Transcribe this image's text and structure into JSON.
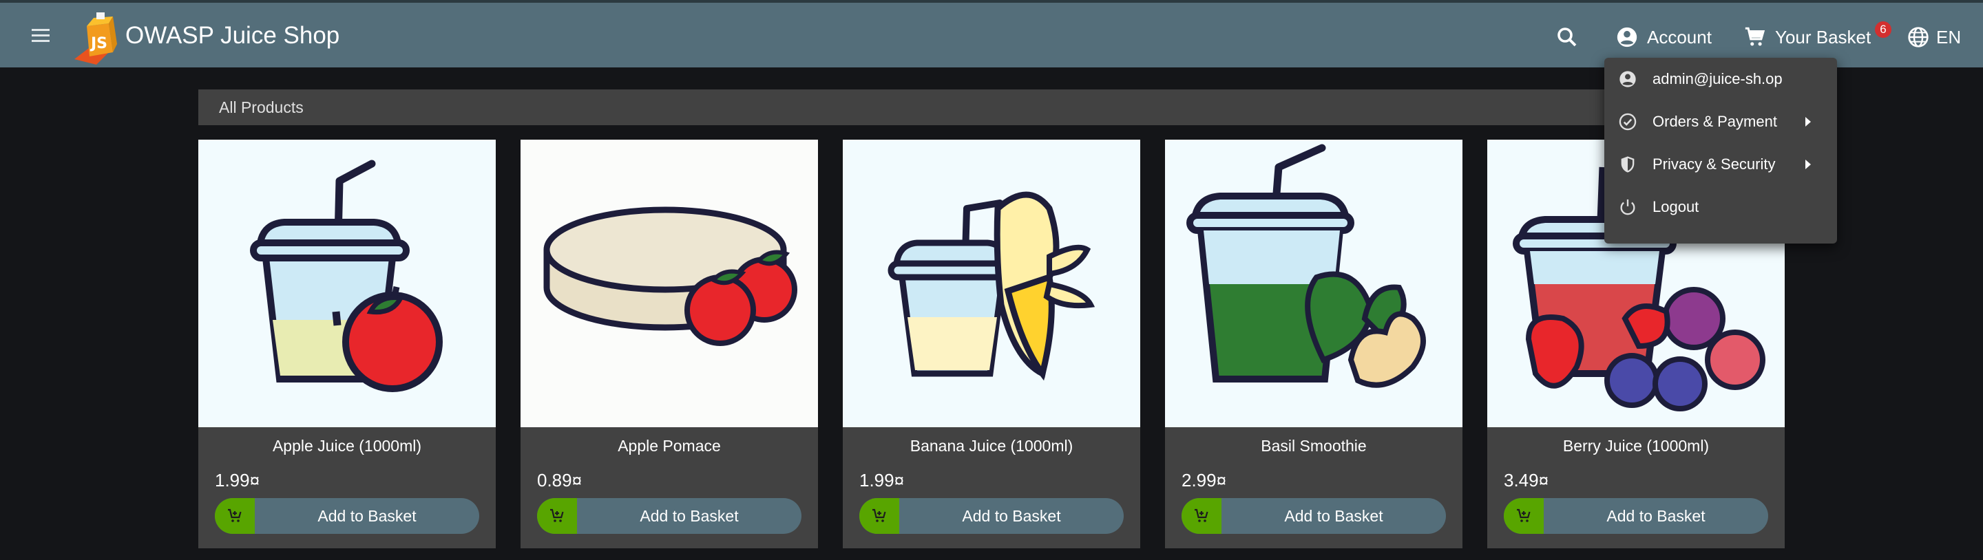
{
  "header": {
    "app_title": "OWASP Juice Shop",
    "logo_text": "JS",
    "account_label": "Account",
    "basket_label": "Your Basket",
    "basket_count": "6",
    "language_label": "EN"
  },
  "main": {
    "section_title": "All Products",
    "add_label": "Add to Basket",
    "products": [
      {
        "name": "Apple Juice (1000ml)",
        "price": "1.99¤",
        "icon": "apple-juice-image"
      },
      {
        "name": "Apple Pomace",
        "price": "0.89¤",
        "icon": "apple-pomace-image"
      },
      {
        "name": "Banana Juice (1000ml)",
        "price": "1.99¤",
        "icon": "banana-juice-image"
      },
      {
        "name": "Basil Smoothie",
        "price": "2.99¤",
        "icon": "basil-smoothie-image"
      },
      {
        "name": "Berry Juice (1000ml)",
        "price": "3.49¤",
        "icon": "berry-juice-image"
      }
    ]
  },
  "account_menu": {
    "email": "admin@juice-sh.op",
    "orders_payment": "Orders & Payment",
    "privacy_security": "Privacy & Security",
    "logout": "Logout"
  },
  "colors": {
    "toolbar": "#546e7a",
    "background": "#141518",
    "card": "#424242",
    "cart_accent": "#58a500",
    "badge": "#d32f2f"
  }
}
